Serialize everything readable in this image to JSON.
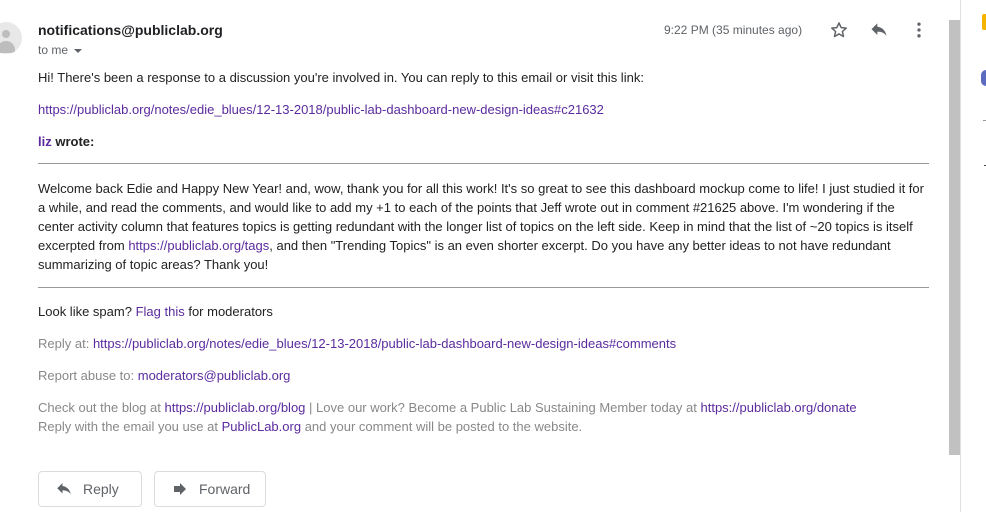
{
  "header": {
    "sender": "notifications@publiclab.org",
    "recipient": "to me",
    "timestamp": "9:22 PM (35 minutes ago)"
  },
  "body": {
    "intro": "Hi! There's been a response to a discussion you're involved in. You can reply to this email or visit this link:",
    "discussion_link": "https://publiclab.org/notes/edie_blues/12-13-2018/public-lab-dashboard-new-design-ideas#c21632",
    "author": "liz",
    "wrote": "wrote:",
    "comment_part1": "Welcome back Edie and Happy New Year! and, wow, thank you for all this work! It's so great to see this dashboard mockup come to life! I just studied it for a while, and read the comments, and would like to add my +1 to each of the points that Jeff wrote out in comment #21625 above. I'm wondering if the center activity column that features topics is getting redundant with the longer list of topics on the left side. Keep in mind that the list of ~20 topics is itself excerpted from ",
    "comment_link": "https://publiclab.org/tags",
    "comment_part2": ", and then \"Trending Topics\" is an even shorter excerpt. Do you have any better ideas to not have redundant summarizing of topic areas? Thank you!"
  },
  "footer": {
    "spam_prefix": "Look like spam?",
    "spam_link": "Flag this",
    "spam_suffix": "for moderators",
    "reply_at_label": "Reply at:",
    "reply_at_link": "https://publiclab.org/notes/edie_blues/12-13-2018/public-lab-dashboard-new-design-ideas#comments",
    "report_label": "Report abuse to:",
    "report_link": "moderators@publiclab.org",
    "blog_prefix": "Check out the blog at",
    "blog_link": "https://publiclab.org/blog",
    "blog_middle": "| Love our work? Become a Public Lab Sustaining Member today at",
    "donate_link": "https://publiclab.org/donate",
    "reply_with_prefix": "Reply with the email you use at",
    "reply_with_link": "PublicLab.org",
    "reply_with_suffix": "and your comment will be posted to the website."
  },
  "actions": {
    "reply_label": "Reply",
    "forward_label": "Forward"
  },
  "icons": {
    "star": "star-icon",
    "reply": "reply-icon",
    "more": "more-vert-icon",
    "forward": "forward-icon"
  },
  "colors": {
    "link": "#1a0dab",
    "visited_link": "#5b2b9e",
    "muted_text": "#888888"
  }
}
